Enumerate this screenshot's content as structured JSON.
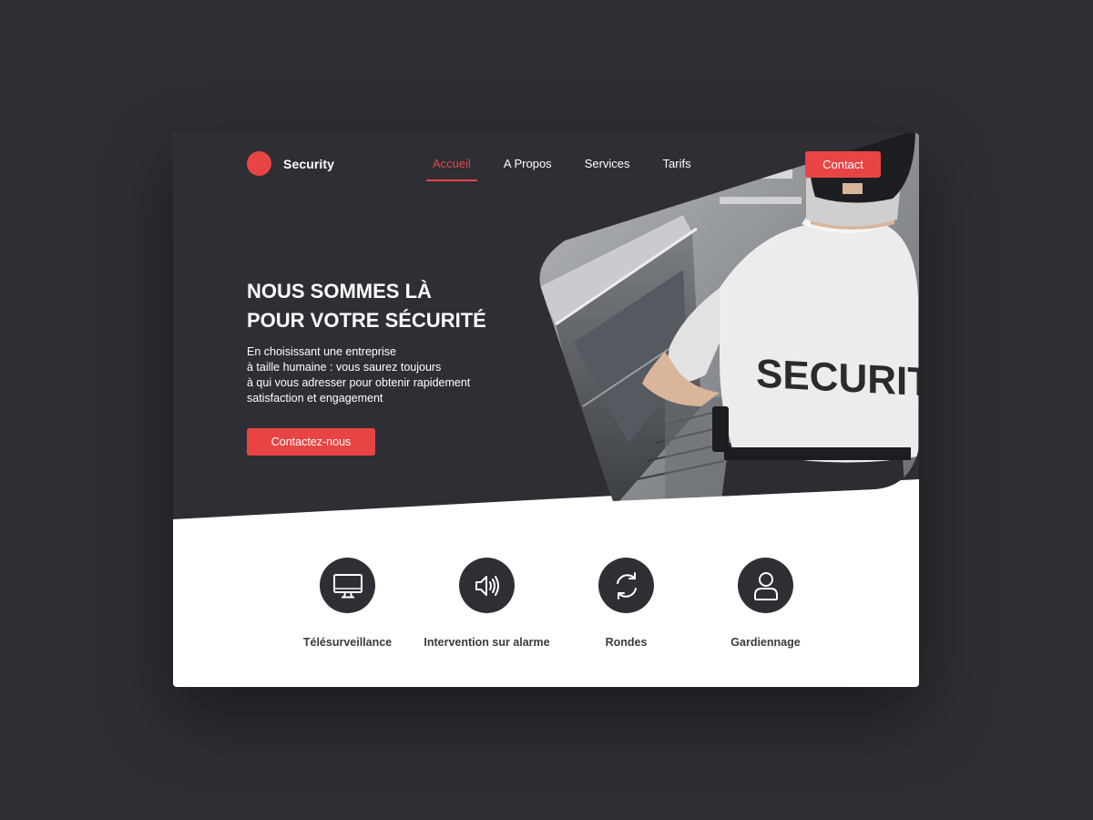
{
  "colors": {
    "background": "#2f2e35",
    "accent": "#e84444",
    "card": "#ffffff"
  },
  "brand": {
    "name": "Security",
    "logo_icon": "red-circle-icon"
  },
  "nav": {
    "items": [
      {
        "label": "Accueil",
        "active": true
      },
      {
        "label": "A Propos",
        "active": false
      },
      {
        "label": "Services",
        "active": false
      },
      {
        "label": "Tarifs",
        "active": false
      }
    ],
    "contact_label": "Contact"
  },
  "hero": {
    "title_lines": [
      "NOUS SOMMES LÀ",
      "POUR VOTRE SÉCURITÉ"
    ],
    "description_lines": [
      "En choisissant une entreprise",
      "à taille humaine : vous saurez toujours",
      "à qui vous adresser pour obtenir rapidement",
      "satisfaction et engagement"
    ],
    "cta_label": "Contactez-nous",
    "image_shirt_text": "SECURITY"
  },
  "services": [
    {
      "label": "Télésurveillance",
      "icon": "monitor-icon"
    },
    {
      "label": "Intervention sur alarme",
      "icon": "speaker-icon"
    },
    {
      "label": "Rondes",
      "icon": "refresh-icon"
    },
    {
      "label": "Gardiennage",
      "icon": "user-icon"
    }
  ]
}
